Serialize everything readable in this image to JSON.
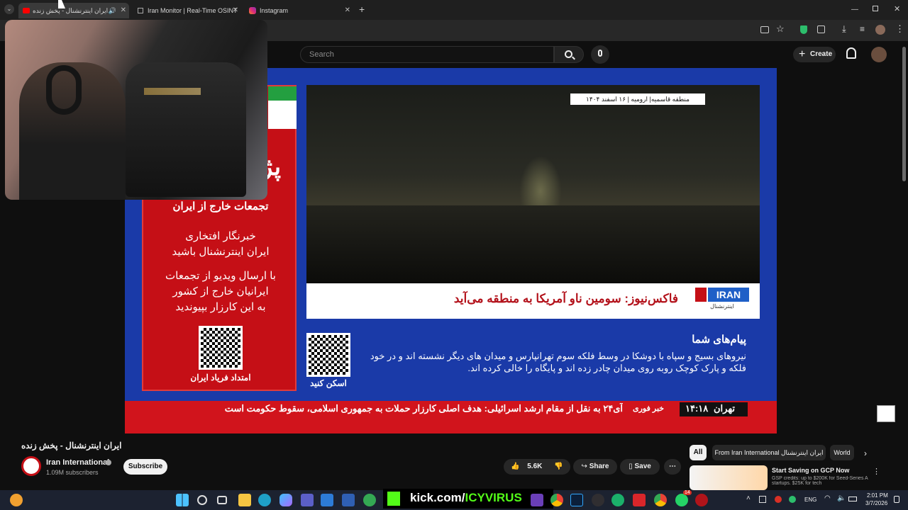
{
  "browser": {
    "tabs": [
      {
        "title": "ایران اینترنشنال - پخش زنده",
        "audio_icon": "speaker-icon"
      },
      {
        "title": "Iran Monitor | Real-Time OSINT"
      },
      {
        "title": "Instagram"
      }
    ],
    "new_tab": "+"
  },
  "youtube": {
    "search_placeholder": "Search",
    "create_label": "Create",
    "video": {
      "location_caption": "منطقه قاسمیه| ارومیه | ۱۶ اسفند ۱۴۰۴",
      "headline": "فاکس‌نیوز: سومین ناو آمریکا به منطقه می‌آید",
      "logo_text": "IRAN",
      "logo_sub": "اینترنشنال",
      "side_panel": {
        "top_word": "پژ",
        "line1": "تجمعات خارج از ایران",
        "line2": "خبرنگار افتخاری",
        "line3": "ایران اینترنشنال باشید",
        "line4": "با ارسال ویدیو از تجمعات",
        "line5": "ایرانیان خارج از کشور",
        "line6": "به این کارزار بپیوندید",
        "qr_caption": "امتداد فریاد ایران"
      },
      "messages_title": "پیام‌های شما",
      "messages_body": "نیروهای بسیج و سپاه با دوشکا در وسط فلکه سوم تهرانپارس و میدان های دیگر نشسته اند و در خود فلکه و پارک کوچک روبه روی میدان چادر زده اند و پایگاه را خالی کرده اند.",
      "scan_label": "اسکن کنید",
      "ticker_city": "تهران",
      "ticker_time": "۱۴:۱۸",
      "ticker_tag": "خبر فوری",
      "ticker_text": "آی۲۴ به نقل از مقام ارشد اسرائیلی: هدف اصلی کارزار حملات به جمهوری اسلامی، سقوط حکومت است"
    },
    "title": "ایران اینترنشنال - پخش زنده",
    "channel": {
      "name": "Iran International",
      "subscribers": "1.09M subscribers",
      "subscribe_label": "Subscribe"
    },
    "actions": {
      "likes": "5.6K",
      "share": "Share",
      "save": "Save"
    },
    "chips": [
      "All",
      "From Iran International ایران اینترنشنال",
      "World"
    ],
    "ad": {
      "title": "Start Saving on GCP Now",
      "body": "GSP credits: up to $200K for Seed-Series A startups. $25K for tech"
    }
  },
  "overlay": {
    "kick_text": "kick.com/",
    "kick_handle": "ICYVIRUS"
  },
  "taskbar": {
    "lang": "ENG",
    "time": "2:01 PM",
    "date": "3/7/2026",
    "badge": "14"
  }
}
